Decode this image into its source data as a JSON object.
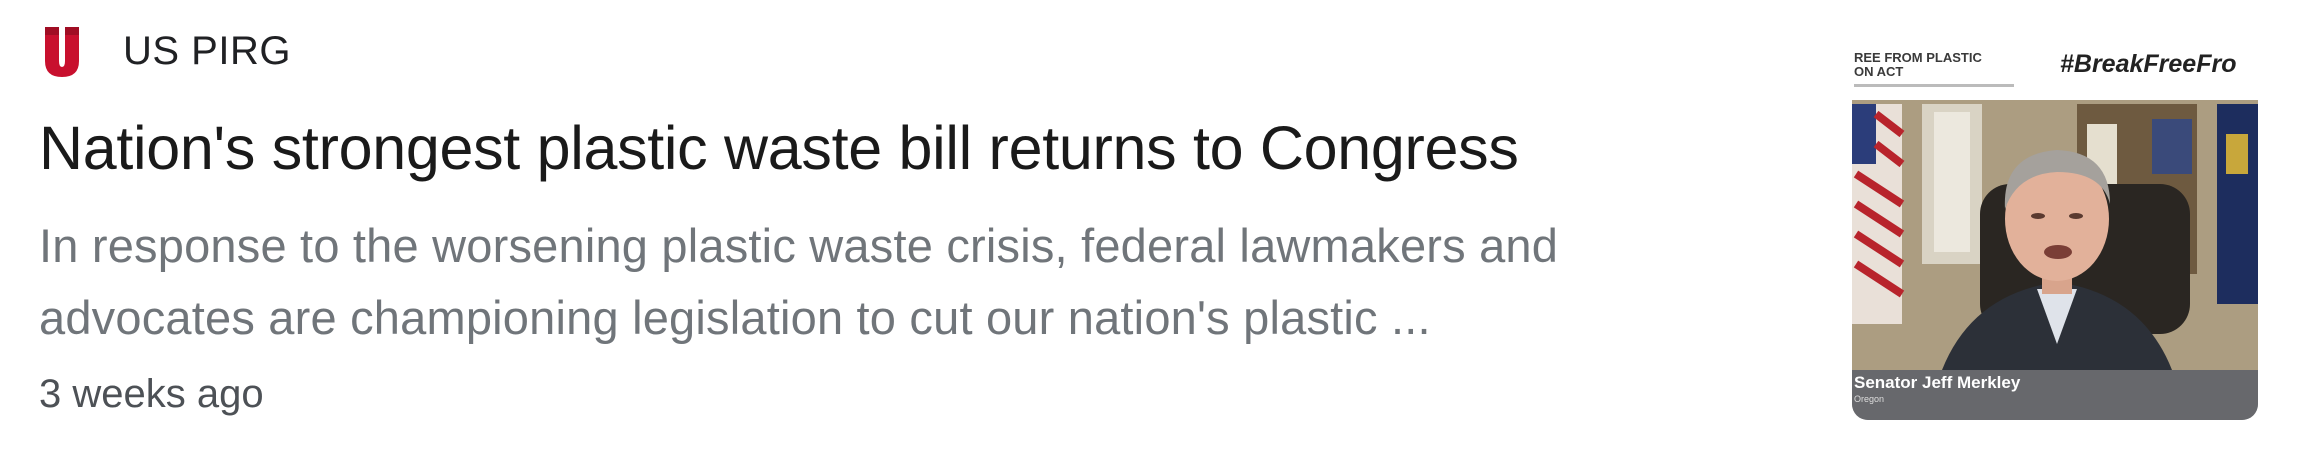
{
  "source": {
    "name": "US PIRG",
    "logo_icon": "us-pirg-logo-icon",
    "logo_letter": "U",
    "logo_color": "#c8102e"
  },
  "headline": "Nation's strongest plastic waste bill returns to Congress",
  "snippet": "In response to the worsening plastic waste crisis, federal lawmakers and advocates are championing legislation to cut our nation's plastic ...",
  "time": "3 weeks ago",
  "thumbnail": {
    "banner_left": "REE FROM PLASTIC\nON ACT",
    "banner_right": "#BreakFreeFro",
    "caption": "Senator Jeff Merkley",
    "caption_sub": "Oregon"
  }
}
